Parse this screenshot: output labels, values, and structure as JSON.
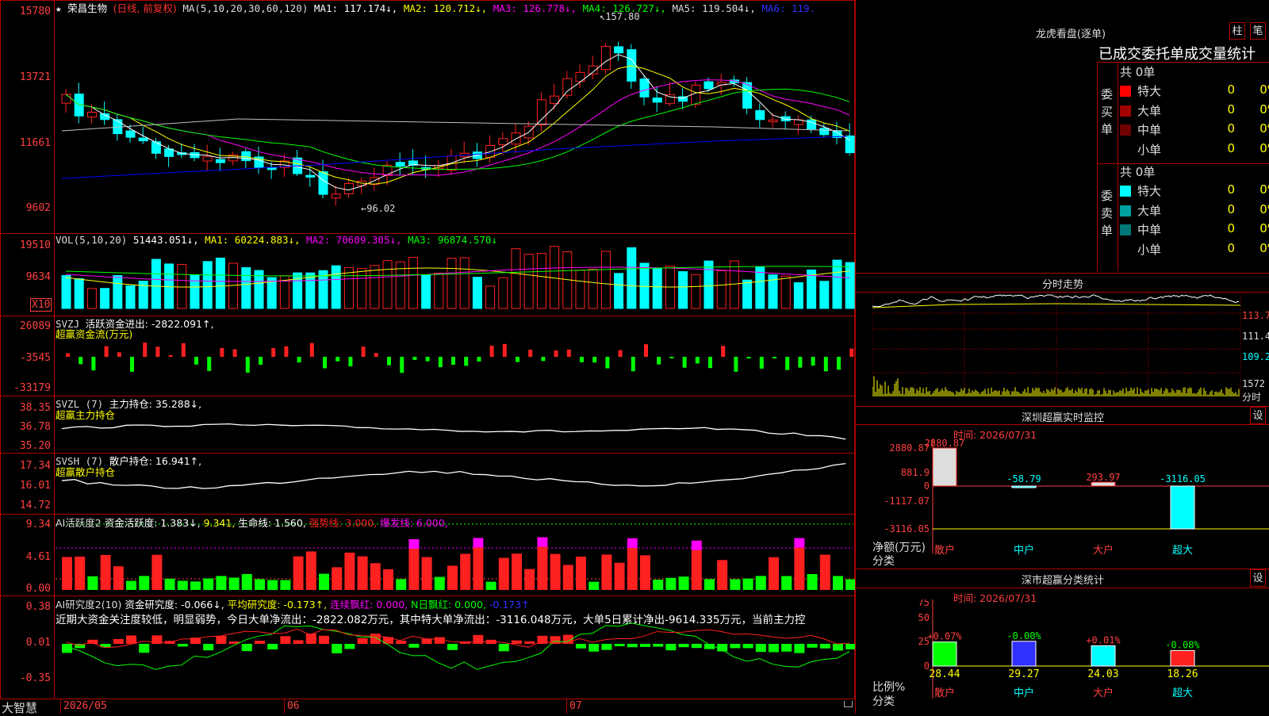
{
  "colors": {
    "up": "#ff2020",
    "down": "#00ffff",
    "grid": "#b00000",
    "ma1": "#ffffff",
    "ma2": "#ffff00",
    "ma3": "#ff00ff",
    "ma4": "#00ff00",
    "ma5": "#c0c0c0",
    "ma6": "#0000ff",
    "green": "#00ff00",
    "magenta": "#ff00ff"
  },
  "kline": {
    "star": "★",
    "stock_name": "荣昌生物",
    "period": "(日线, 前复权)",
    "ma_params": "MA(5,10,20,30,60,120)",
    "ma1": "MA1: 117.174↓,",
    "ma2": "MA2: 120.712↓,",
    "ma3": "MA3: 126.778↓,",
    "ma4": "MA4: 126.727↓,",
    "ma5": "MA5: 119.504↓,",
    "ma6": "MA6: 119.",
    "y_labels": [
      "15780",
      "13721",
      "11661",
      "9602"
    ],
    "high_mark": "157.80",
    "low_mark": "96.02"
  },
  "vol": {
    "title": "VOL(5,10,20)",
    "value": "51443.051↓,",
    "ma1": "MA1: 60224.883↓,",
    "ma2": "MA2: 70609.305↓,",
    "ma3": "MA3: 96874.570↓",
    "y_labels": [
      "19510",
      "9634"
    ],
    "unit": "X10"
  },
  "svzj": {
    "title": "SVZJ",
    "line1": "活跃资金进出: -2822.091↑,",
    "line2": "超赢资金流(万元)",
    "y_labels": [
      "26089",
      "-3545",
      "-33179"
    ]
  },
  "svzl": {
    "title": "SVZL (7)",
    "line1": "主力持仓: 35.288↓,",
    "line2": "超赢主力持仓",
    "y_labels": [
      "38.35",
      "36.78",
      "35.20"
    ]
  },
  "svsh": {
    "title": "SVSH (7)",
    "line1": "散户持仓: 16.941↑,",
    "line2": "超赢散户持仓",
    "y_labels": [
      "17.34",
      "16.01",
      "14.72"
    ]
  },
  "ai1": {
    "title": "AI活跃度2",
    "v1": "资金活跃度: 1.383↓,",
    "v2": "9.341,",
    "v3": "生命线: 1.560,",
    "v4": "强势线: 3.000,",
    "v5": "爆发线: 6.000,",
    "y_labels": [
      "9.34",
      "4.61",
      "0.00"
    ]
  },
  "ai2": {
    "title": "AI研究度2(10)",
    "v1": "资金研究度: -0.066↓,",
    "v2": "平均研究度: -0.173↑,",
    "v3": "连续飘红: 0.000,",
    "v4": "N日飘红: 0.000,",
    "v5": "-0.173↑",
    "comment": "近期大资金关注度较低，明显弱势，今日大单净流出：-2822.082万元，其中特大单净流出：-3116.048万元，大单5日累计净出-9614.335万元，当前主力控",
    "y_labels": [
      "0.38",
      "0.01",
      "-0.35"
    ]
  },
  "bottom": {
    "brand": "大智慧",
    "dates": [
      "2026/05",
      "06",
      "07"
    ]
  },
  "dragon": {
    "title": "龙虎看盘(逐单)",
    "btn_bar": "柱",
    "btn_count": "笔",
    "heading": "已成交委托单成交量统计",
    "buy_label": "委买单",
    "sell_label": "委卖单",
    "buy_total": "共 0单",
    "sell_total": "共 0单",
    "buy_rows": [
      {
        "name": "特大",
        "count": "0",
        "pct": "0%",
        "color": "#ff0000"
      },
      {
        "name": "大单",
        "count": "0",
        "pct": "0%",
        "color": "#a00000"
      },
      {
        "name": "中单",
        "count": "0",
        "pct": "0%",
        "color": "#700000"
      },
      {
        "name": "小单",
        "count": "0",
        "pct": "0%",
        "color": "#000000"
      }
    ],
    "sell_rows": [
      {
        "name": "特大",
        "count": "0",
        "pct": "0%",
        "color": "#00ffff"
      },
      {
        "name": "大单",
        "count": "0",
        "pct": "0%",
        "color": "#00a0a0"
      },
      {
        "name": "中单",
        "count": "0",
        "pct": "0%",
        "color": "#007878"
      },
      {
        "name": "小单",
        "count": "0",
        "pct": "0%",
        "color": "#000000"
      }
    ]
  },
  "intraday": {
    "title": "分时走势",
    "y_labels": [
      "113.7",
      "111.4",
      "109.2"
    ],
    "vol_label": "1572",
    "vol_unit": "分时"
  },
  "sz_monitor": {
    "title": "深圳超赢实时监控",
    "btn": "设",
    "time": "时间: 2026/07/31",
    "y_labels": [
      "2880.87",
      "881.9",
      "0",
      "-1117.07",
      "-3116.05"
    ],
    "unit": "净额(万元)",
    "cat_label": "分类",
    "categories": [
      "散户",
      "中户",
      "大户",
      "超大"
    ],
    "values": [
      2880.87,
      -58.79,
      293.97,
      -3116.05
    ],
    "value_labels": [
      "2880.87",
      "-58.79",
      "293.97",
      "-3116.05"
    ]
  },
  "sz_class": {
    "title": "深市超赢分类统计",
    "btn": "设",
    "time": "时间: 2026/07/31",
    "y_labels": [
      "75",
      "50",
      "25",
      "0"
    ],
    "unit": "比例%",
    "cat_label": "分类",
    "categories": [
      "散户",
      "中户",
      "大户",
      "超大"
    ],
    "values": [
      28.44,
      29.27,
      24.03,
      18.26
    ],
    "changes": [
      "+0.07%",
      "-0.00%",
      "+0.01%",
      "-0.08%"
    ],
    "value_labels": [
      "28.44",
      "29.27",
      "24.03",
      "18.26"
    ]
  }
}
